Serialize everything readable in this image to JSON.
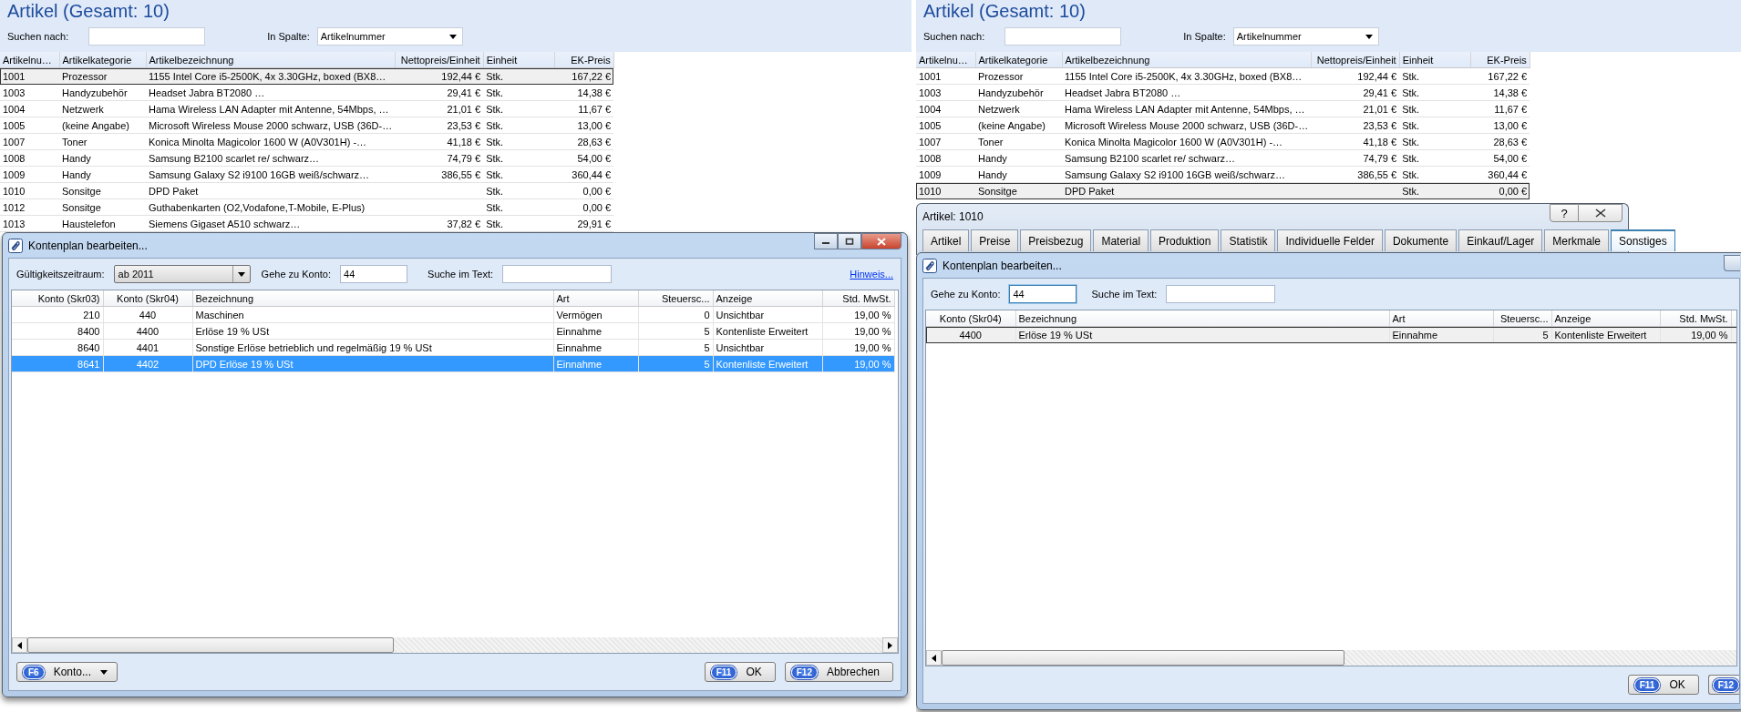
{
  "panels": [
    {
      "article_list": {
        "title": "Artikel (Gesamt: 10)",
        "search_label": "Suchen nach:",
        "column_label": "In Spalte:",
        "column_value": "Artikelnummer",
        "columns": [
          "Artikelnu…",
          "Artikelkategorie",
          "Artikelbezeichnung",
          "Nettopreis/Einheit",
          "Einheit",
          "EK-Preis"
        ],
        "rows": [
          {
            "cells": [
              "1001",
              "Prozessor",
              "1155 Intel Core i5-2500K, 4x 3.30GHz, boxed (BX8…",
              "192,44 €",
              "Stk.",
              "167,22 €"
            ],
            "selected": true
          },
          {
            "cells": [
              "1003",
              "Handyzubehör",
              "Headset Jabra BT2080 …",
              "29,41 €",
              "Stk.",
              "14,38 €"
            ],
            "selected": false
          },
          {
            "cells": [
              "1004",
              "Netzwerk",
              "Hama Wireless LAN Adapter mit Antenne, 54Mbps, …",
              "21,01 €",
              "Stk.",
              "11,67 €"
            ],
            "selected": false
          },
          {
            "cells": [
              "1005",
              "(keine Angabe)",
              "Microsoft Wireless Mouse 2000 schwarz, USB (36D-…",
              "23,53 €",
              "Stk.",
              "13,00 €"
            ],
            "selected": false
          },
          {
            "cells": [
              "1007",
              "Toner",
              "Konica Minolta Magicolor 1600 W (A0V301H) -…",
              "41,18 €",
              "Stk.",
              "28,63 €"
            ],
            "selected": false
          },
          {
            "cells": [
              "1008",
              "Handy",
              "Samsung B2100 scarlet re/ schwarz…",
              "74,79 €",
              "Stk.",
              "54,00 €"
            ],
            "selected": false
          },
          {
            "cells": [
              "1009",
              "Handy",
              "Samsung Galaxy S2 i9100 16GB weiß/schwarz…",
              "386,55 €",
              "Stk.",
              "360,44 €"
            ],
            "selected": false
          },
          {
            "cells": [
              "1010",
              "Sonsitge",
              "DPD Paket",
              "",
              "Stk.",
              "0,00 €"
            ],
            "selected": false
          },
          {
            "cells": [
              "1012",
              "Sonsitge",
              "Guthabenkarten (O2,Vodafone,T-Mobile, E-Plus)",
              "",
              "Stk.",
              "0,00 €"
            ],
            "selected": false
          },
          {
            "cells": [
              "1013",
              "Haustelefon",
              "Siemens Gigaset A510 schwarz…",
              "37,82 €",
              "Stk.",
              "29,91 €"
            ],
            "selected": false
          }
        ]
      },
      "account_dialog": {
        "title": "Kontenplan bearbeiten...",
        "period": {
          "label": "Gültigkeitszeitraum:",
          "value": "ab 2011"
        },
        "goto": {
          "label": "Gehe zu Konto:",
          "value": "44",
          "focused": false
        },
        "text_search": {
          "label": "Suche im Text:"
        },
        "hint_link": "Hinweis...",
        "table_focused": true,
        "columns": [
          "Konto (Skr03)",
          "Konto (Skr04)",
          "Bezeichnung",
          "Art",
          "Steuersc...",
          "Anzeige",
          "Std. MwSt."
        ],
        "rows": [
          {
            "cells": [
              "210",
              "440",
              "Maschinen",
              "Vermögen",
              "0",
              "Unsichtbar",
              "19,00 %"
            ],
            "selected": false
          },
          {
            "cells": [
              "8400",
              "4400",
              "Erlöse 19 % USt",
              "Einnahme",
              "5",
              "Kontenliste Erweitert",
              "19,00 %"
            ],
            "selected": false
          },
          {
            "cells": [
              "8640",
              "4401",
              "Sonstige Erlöse betrieblich und regelmäßig 19 % USt",
              "Einnahme",
              "5",
              "Unsichtbar",
              "19,00 %"
            ],
            "selected": false
          },
          {
            "cells": [
              "8641",
              "4402",
              "DPD Erlöse 19 % USt",
              "Einnahme",
              "5",
              "Kontenliste Erweitert",
              "19,00 %"
            ],
            "selected": true
          }
        ],
        "menu_button": {
          "key": "F6",
          "label": "Konto..."
        },
        "buttons": [
          {
            "key": "F11",
            "label": "OK"
          },
          {
            "key": "F12",
            "label": "Abbrechen"
          }
        ]
      }
    },
    {
      "article_list": {
        "title": "Artikel (Gesamt: 10)",
        "search_label": "Suchen nach:",
        "column_label": "In Spalte:",
        "column_value": "Artikelnummer",
        "columns": [
          "Artikelnu…",
          "Artikelkategorie",
          "Artikelbezeichnung",
          "Nettopreis/Einheit",
          "Einheit",
          "EK-Preis"
        ],
        "rows": [
          {
            "cells": [
              "1001",
              "Prozessor",
              "1155 Intel Core i5-2500K, 4x 3.30GHz, boxed (BX8…",
              "192,44 €",
              "Stk.",
              "167,22 €"
            ],
            "selected": false
          },
          {
            "cells": [
              "1003",
              "Handyzubehör",
              "Headset Jabra BT2080 …",
              "29,41 €",
              "Stk.",
              "14,38 €"
            ],
            "selected": false
          },
          {
            "cells": [
              "1004",
              "Netzwerk",
              "Hama Wireless LAN Adapter mit Antenne, 54Mbps, …",
              "21,01 €",
              "Stk.",
              "11,67 €"
            ],
            "selected": false
          },
          {
            "cells": [
              "1005",
              "(keine Angabe)",
              "Microsoft Wireless Mouse 2000 schwarz, USB (36D-…",
              "23,53 €",
              "Stk.",
              "13,00 €"
            ],
            "selected": false
          },
          {
            "cells": [
              "1007",
              "Toner",
              "Konica Minolta Magicolor 1600 W (A0V301H) -…",
              "41,18 €",
              "Stk.",
              "28,63 €"
            ],
            "selected": false
          },
          {
            "cells": [
              "1008",
              "Handy",
              "Samsung B2100 scarlet re/ schwarz…",
              "74,79 €",
              "Stk.",
              "54,00 €"
            ],
            "selected": false
          },
          {
            "cells": [
              "1009",
              "Handy",
              "Samsung Galaxy S2 i9100 16GB weiß/schwarz…",
              "386,55 €",
              "Stk.",
              "360,44 €"
            ],
            "selected": false
          },
          {
            "cells": [
              "1010",
              "Sonsitge",
              "DPD Paket",
              "",
              "Stk.",
              "0,00 €"
            ],
            "selected": true
          }
        ]
      },
      "article_dialog": {
        "title": "Artikel: 1010",
        "help_symbol": "?",
        "tabs": [
          {
            "label": "Artikel",
            "selected": false
          },
          {
            "label": "Preise",
            "selected": false
          },
          {
            "label": "Preisbezug",
            "selected": false
          },
          {
            "label": "Material",
            "selected": false
          },
          {
            "label": "Produktion",
            "selected": false
          },
          {
            "label": "Statistik",
            "selected": false
          },
          {
            "label": "Individuelle Felder",
            "selected": false
          },
          {
            "label": "Dokumente",
            "selected": false
          },
          {
            "label": "Einkauf/Lager",
            "selected": false
          },
          {
            "label": "Merkmale",
            "selected": false
          },
          {
            "label": "Sonstiges",
            "selected": true
          }
        ]
      },
      "account_dialog": {
        "title": "Kontenplan bearbeiten...",
        "goto": {
          "label": "Gehe zu Konto:",
          "value": "44",
          "focused": true
        },
        "text_search": {
          "label": "Suche im Text:"
        },
        "table_focused": false,
        "columns": [
          "Konto (Skr04)",
          "Bezeichnung",
          "Art",
          "Steuersc...",
          "Anzeige",
          "Std. MwSt."
        ],
        "rows": [
          {
            "cells": [
              "4400",
              "Erlöse 19 % USt",
              "Einnahme",
              "5",
              "Kontenliste Erweitert",
              "19,00 %"
            ],
            "selected": true
          }
        ],
        "buttons": [
          {
            "key": "F11",
            "label": "OK"
          },
          {
            "key": "F12"
          }
        ]
      }
    }
  ]
}
